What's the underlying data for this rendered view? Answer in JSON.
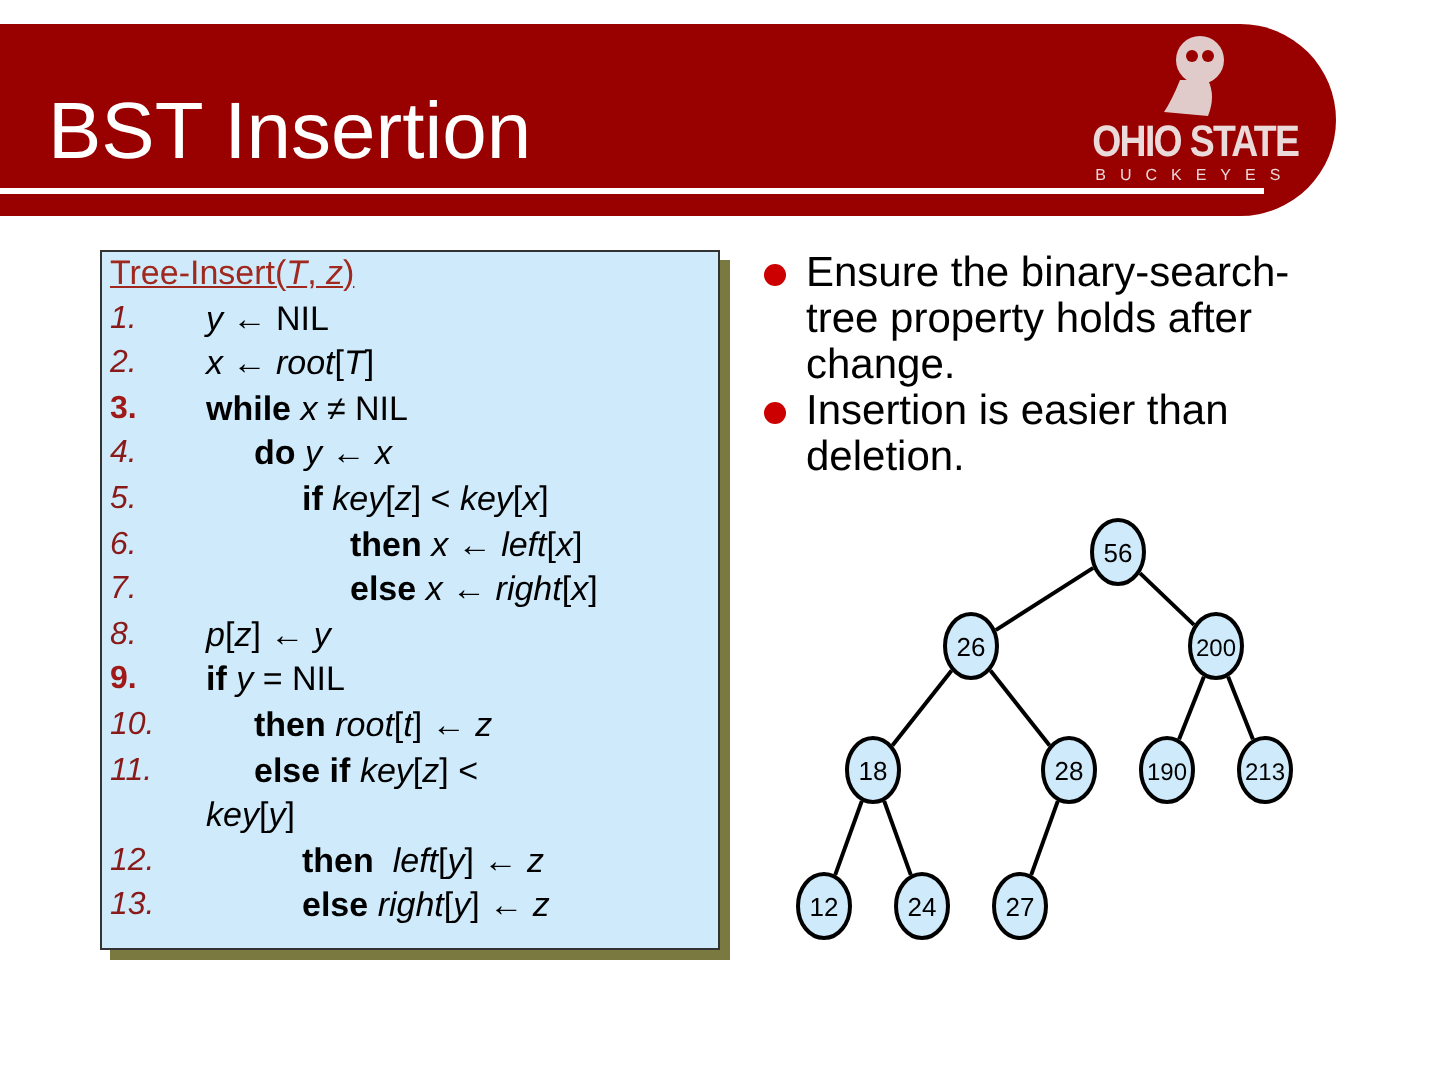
{
  "header": {
    "title": "BST Insertion",
    "logo": {
      "wordmark": "OHIO STATE",
      "tagline": "BUCKEYES"
    }
  },
  "code": {
    "title": "Tree-Insert(*T*, *z*)",
    "lines": [
      {
        "number": "1.",
        "emphasized": false,
        "text": "*y* ← NIL"
      },
      {
        "number": "2.",
        "emphasized": false,
        "text": "*x* ← *root*[*T*]"
      },
      {
        "number": "3.",
        "emphasized": true,
        "text": "**while** *x* ≠ NIL",
        "children": [
          {
            "number": "4.",
            "emphasized": false,
            "text": "**do** *y* ← *x*",
            "children": [
              {
                "number": "5.",
                "emphasized": false,
                "text": "**if** *key*[*z*] < *key*[*x*]",
                "children": [
                  {
                    "number": "6.",
                    "emphasized": false,
                    "text": "**then** *x* ← *left*[*x*]"
                  },
                  {
                    "number": "7.",
                    "emphasized": false,
                    "text": "**else** *x* ← *right*[*x*]"
                  }
                ]
              }
            ]
          }
        ]
      },
      {
        "number": "8.",
        "emphasized": false,
        "text": "*p*[*z*] ← *y*"
      },
      {
        "number": "9.",
        "emphasized": true,
        "text": "**if** *y* = NIL",
        "children": [
          {
            "number": "10.",
            "emphasized": false,
            "text": "**then** *root*[*t*] ← *z*"
          },
          {
            "number": "11.",
            "emphasized": false,
            "text": "**else if** *key*[*z*] <",
            "continuation": "*key*[*y*]",
            "children": [
              {
                "number": "12.",
                "emphasized": false,
                "text": "**then**  *left*[*y*] ← *z*"
              },
              {
                "number": "13.",
                "emphasized": false,
                "text": "**else** *right*[*y*] ← *z*"
              }
            ]
          }
        ]
      }
    ]
  },
  "bullets": [
    "Ensure the binary-search-tree property holds after change.",
    "Insertion is easier than deletion."
  ],
  "tree": {
    "key": "56",
    "left": {
      "key": "26",
      "left": {
        "key": "18",
        "left": {
          "key": "12"
        },
        "right": {
          "key": "24"
        }
      },
      "right": {
        "key": "28",
        "left": {
          "key": "27"
        }
      }
    },
    "right": {
      "key": "200",
      "left": {
        "key": "190"
      },
      "right": {
        "key": "213"
      }
    }
  }
}
